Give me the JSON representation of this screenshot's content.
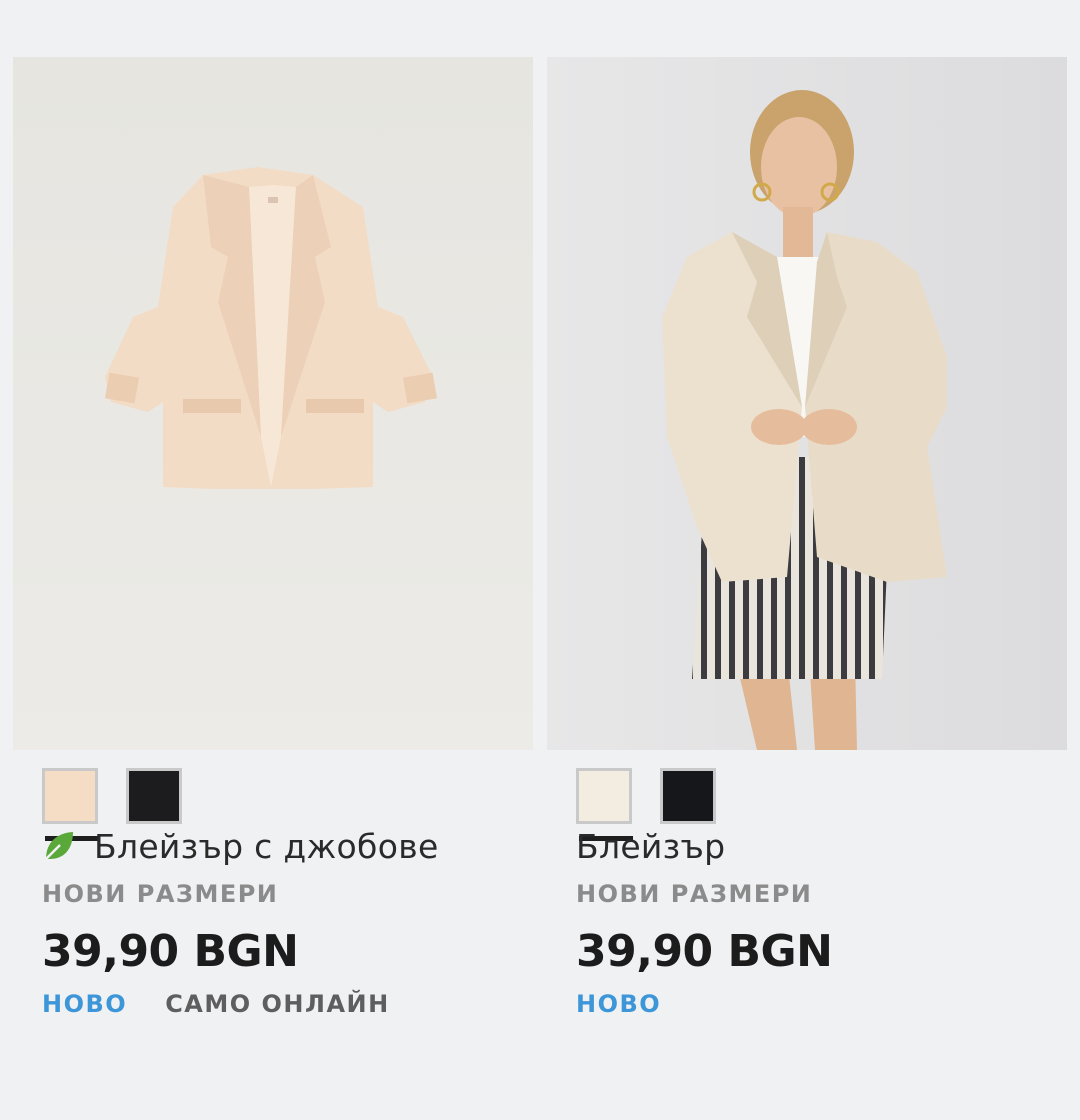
{
  "products": [
    {
      "title": "Блейзър с джобове",
      "eco_icon": "leaf-icon",
      "sizes_label": "НОВИ РАЗМЕРИ",
      "price": "39,90 BGN",
      "badges": [
        "НОВО",
        "САМО ОНЛАЙН"
      ],
      "swatches": [
        "#f5dcc5",
        "#1c1c1e"
      ],
      "selected_swatch": 0
    },
    {
      "title": "Блейзър",
      "sizes_label": "НОВИ РАЗМЕРИ",
      "price": "39,90 BGN",
      "badges": [
        "НОВО"
      ],
      "swatches": [
        "#f3ece0",
        "#15171b"
      ],
      "selected_swatch": 0
    }
  ],
  "colors": {
    "background": "#f0f1f3",
    "new_badge": "#3d96d8",
    "eco_leaf": "#5aa83a"
  }
}
